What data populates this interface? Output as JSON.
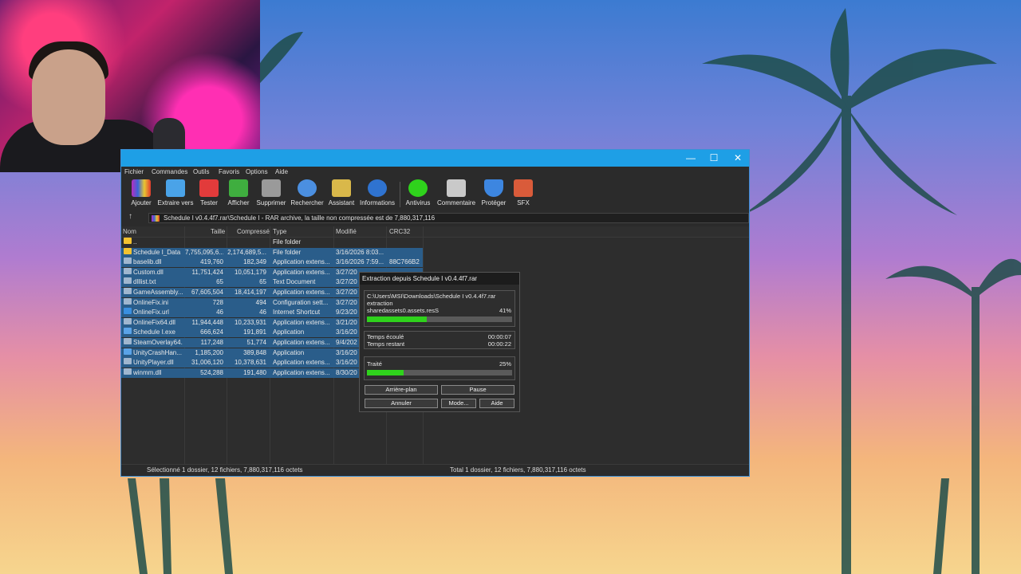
{
  "window": {
    "controls": {
      "minimize": "—",
      "maximize": "☐",
      "close": "✕"
    },
    "menu": [
      "Fichier",
      "Commandes",
      "Outils",
      "Favoris",
      "Options",
      "Aide"
    ]
  },
  "toolbar": [
    {
      "label": "Ajouter",
      "color": "#e84c3d"
    },
    {
      "label": "Extraire vers",
      "color": "#4aa3e8"
    },
    {
      "label": "Tester",
      "color": "#e23b3b"
    },
    {
      "label": "Afficher",
      "color": "#3fae3f"
    },
    {
      "label": "Supprimer",
      "color": "#9a9a9a"
    },
    {
      "label": "Rechercher",
      "color": "#4b8fe0"
    },
    {
      "label": "Assistant",
      "color": "#d9b84a"
    },
    {
      "label": "Informations",
      "color": "#2f73d0"
    },
    {
      "label": "Antivirus",
      "color": "#2fd21c"
    },
    {
      "label": "Commentaire",
      "color": "#c9c9c9"
    },
    {
      "label": "Protéger",
      "color": "#3d86e0"
    },
    {
      "label": "SFX",
      "color": "#d95b3a"
    }
  ],
  "address": {
    "up_icon": "↑",
    "path": "Schedule I v0.4.4f7.rar\\Schedule I - RAR archive, la taille non compressée est de 7,880,317,116"
  },
  "columns": [
    "Nom",
    "Taille",
    "Compressé",
    "Type",
    "Modifié",
    "CRC32"
  ],
  "files": [
    {
      "name": "..",
      "size": "",
      "packed": "",
      "type": "File folder",
      "modified": "",
      "crc": "",
      "kind": "folder",
      "selected": false
    },
    {
      "name": "Schedule I_Data",
      "size": "7,755,095,6...",
      "packed": "2,174,689,5...",
      "type": "File folder",
      "modified": "3/16/2026 8:03...",
      "crc": "",
      "kind": "folder",
      "selected": true
    },
    {
      "name": "baselib.dll",
      "size": "419,760",
      "packed": "182,349",
      "type": "Application extens...",
      "modified": "3/16/2026 7:59...",
      "crc": "88C766B2",
      "kind": "file",
      "selected": true
    },
    {
      "name": "Custom.dll",
      "size": "11,751,424",
      "packed": "10,051,179",
      "type": "Application extens...",
      "modified": "3/27/20",
      "crc": "",
      "kind": "file",
      "selected": true
    },
    {
      "name": "dlllist.txt",
      "size": "65",
      "packed": "65",
      "type": "Text Document",
      "modified": "3/27/20",
      "crc": "",
      "kind": "file",
      "selected": true
    },
    {
      "name": "GameAssembly...",
      "size": "67,605,504",
      "packed": "18,414,197",
      "type": "Application extens...",
      "modified": "3/27/20",
      "crc": "",
      "kind": "file",
      "selected": true
    },
    {
      "name": "OnlineFix.ini",
      "size": "728",
      "packed": "494",
      "type": "Configuration sett...",
      "modified": "3/27/20",
      "crc": "",
      "kind": "file",
      "selected": true
    },
    {
      "name": "OnlineFix.url",
      "size": "46",
      "packed": "46",
      "type": "Internet Shortcut",
      "modified": "9/23/20",
      "crc": "",
      "kind": "url",
      "selected": true
    },
    {
      "name": "OnlineFix64.dll",
      "size": "11,944,448",
      "packed": "10,233,931",
      "type": "Application extens...",
      "modified": "3/21/20",
      "crc": "",
      "kind": "file",
      "selected": true
    },
    {
      "name": "Schedule I.exe",
      "size": "666,624",
      "packed": "191,891",
      "type": "Application",
      "modified": "3/16/20",
      "crc": "",
      "kind": "exe",
      "selected": true
    },
    {
      "name": "SteamOverlay64...",
      "size": "117,248",
      "packed": "51,774",
      "type": "Application extens...",
      "modified": "9/4/202",
      "crc": "",
      "kind": "file",
      "selected": true
    },
    {
      "name": "UnityCrashHan...",
      "size": "1,185,200",
      "packed": "389,848",
      "type": "Application",
      "modified": "3/16/20",
      "crc": "",
      "kind": "exe",
      "selected": true
    },
    {
      "name": "UnityPlayer.dll",
      "size": "31,006,120",
      "packed": "10,378,631",
      "type": "Application extens...",
      "modified": "3/16/20",
      "crc": "",
      "kind": "file",
      "selected": true
    },
    {
      "name": "winmm.dll",
      "size": "524,288",
      "packed": "191,480",
      "type": "Application extens...",
      "modified": "8/30/20",
      "crc": "",
      "kind": "file",
      "selected": true
    }
  ],
  "status": {
    "left": "Sélectionné 1 dossier, 12 fichiers, 7,880,317,116 octets",
    "right": "Total 1 dossier, 12 fichiers, 7,880,317,116 octets"
  },
  "dialog": {
    "title": "Extraction depuis Schedule I v0.4.4f7.rar",
    "path": "C:\\Users\\MSI\\Downloads\\Schedule I v0.4.4f7.rar",
    "action": "extraction",
    "current_file": "sharedassets0.assets.resS",
    "file_percent_text": "41%",
    "file_progress": 0.41,
    "elapsed_label": "Temps écoulé",
    "elapsed_value": "00:00:07",
    "remaining_label": "Temps restant",
    "remaining_value": "00:00:22",
    "processed_label": "Traité",
    "processed_percent_text": "25%",
    "total_progress": 0.25,
    "buttons": {
      "background": "Arrière-plan",
      "pause": "Pause",
      "cancel": "Annuler",
      "mode": "Mode...",
      "help": "Aide"
    }
  }
}
